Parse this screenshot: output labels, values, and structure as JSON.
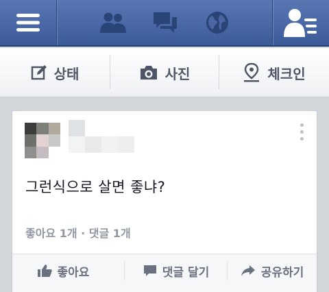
{
  "topbar": {
    "icons": [
      "menu-icon",
      "friend-requests-icon",
      "messages-icon",
      "notifications-globe-icon",
      "contacts-icon"
    ]
  },
  "actionbar": {
    "status_label": "상태",
    "photo_label": "사진",
    "checkin_label": "체크인"
  },
  "post": {
    "text": "그런식으로 살면 좋냐?",
    "counts": "좋아요 1개 · 댓글 1개",
    "actions": {
      "like_label": "좋아요",
      "comment_label": "댓글 달기",
      "share_label": "공유하기"
    }
  },
  "colors": {
    "brand": "#3b5998",
    "text": "#141823",
    "muted": "#9197a3"
  }
}
